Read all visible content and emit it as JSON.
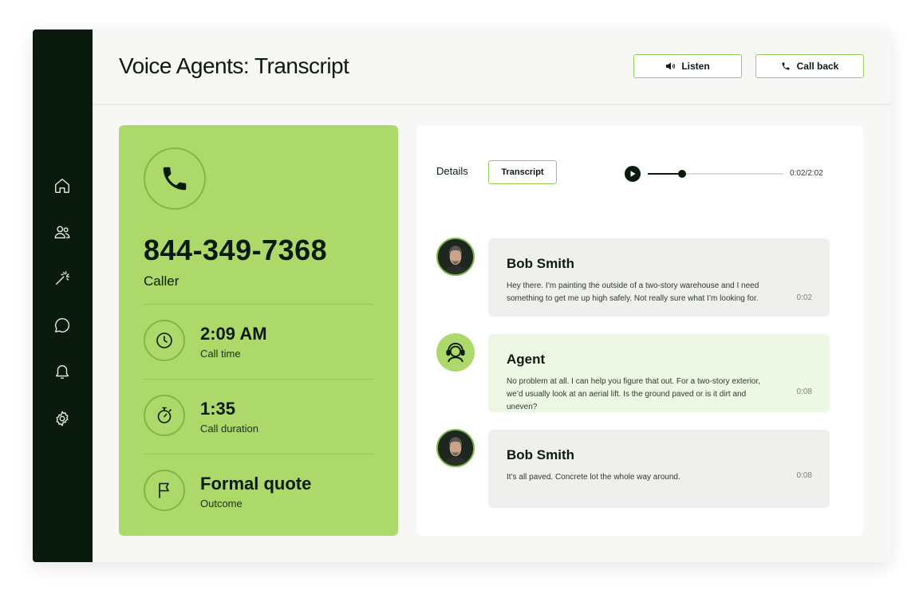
{
  "app": {
    "title": "Voice Agents: Transcript"
  },
  "sidebar": {
    "items": [
      {
        "name": "home",
        "icon": "home-icon"
      },
      {
        "name": "contacts",
        "icon": "users-icon"
      },
      {
        "name": "automations",
        "icon": "magic-wand-icon"
      },
      {
        "name": "messages",
        "icon": "chat-bubble-icon"
      },
      {
        "name": "notifications",
        "icon": "bell-icon"
      },
      {
        "name": "settings",
        "icon": "gear-icon"
      }
    ]
  },
  "header": {
    "listen_label": "Listen",
    "callback_label": "Call back"
  },
  "caller": {
    "phone_number": "844-349-7368",
    "role": "Caller",
    "stats": [
      {
        "value": "2:09 AM",
        "label": "Call time",
        "icon": "clock-icon"
      },
      {
        "value": "1:35",
        "label": "Call duration",
        "icon": "stopwatch-icon"
      },
      {
        "value": "Formal quote",
        "label": "Outcome",
        "icon": "flag-icon"
      }
    ]
  },
  "transcript": {
    "tabs": {
      "details": "Details",
      "transcript": "Transcript"
    },
    "active_tab": "Transcript",
    "audio": {
      "time": "0:02/2:02",
      "progress": 0.25
    },
    "messages": [
      {
        "speaker": "Bob Smith",
        "type": "caller",
        "text": "Hey there. I’m painting the outside of a two-story warehouse and I need something to get me up high safely. Not really sure what I’m looking for.",
        "time": "0:02"
      },
      {
        "speaker": "Agent",
        "type": "agent",
        "text": "No problem at all. I can help you figure that out. For a two-story exterior, we’d usually look at an aerial lift. Is the ground paved or is it dirt and uneven?",
        "time": "0:08"
      },
      {
        "speaker": "Bob Smith",
        "type": "caller",
        "text": "It’s all paved. Concrete lot the whole way around.",
        "time": "0:08"
      }
    ]
  },
  "colors": {
    "sidebar": "#0b1a0e",
    "accent_green": "#add96b",
    "button_border": "#8fcf5a",
    "caller_bubble": "#efefed",
    "agent_bubble": "#eef7e3"
  }
}
